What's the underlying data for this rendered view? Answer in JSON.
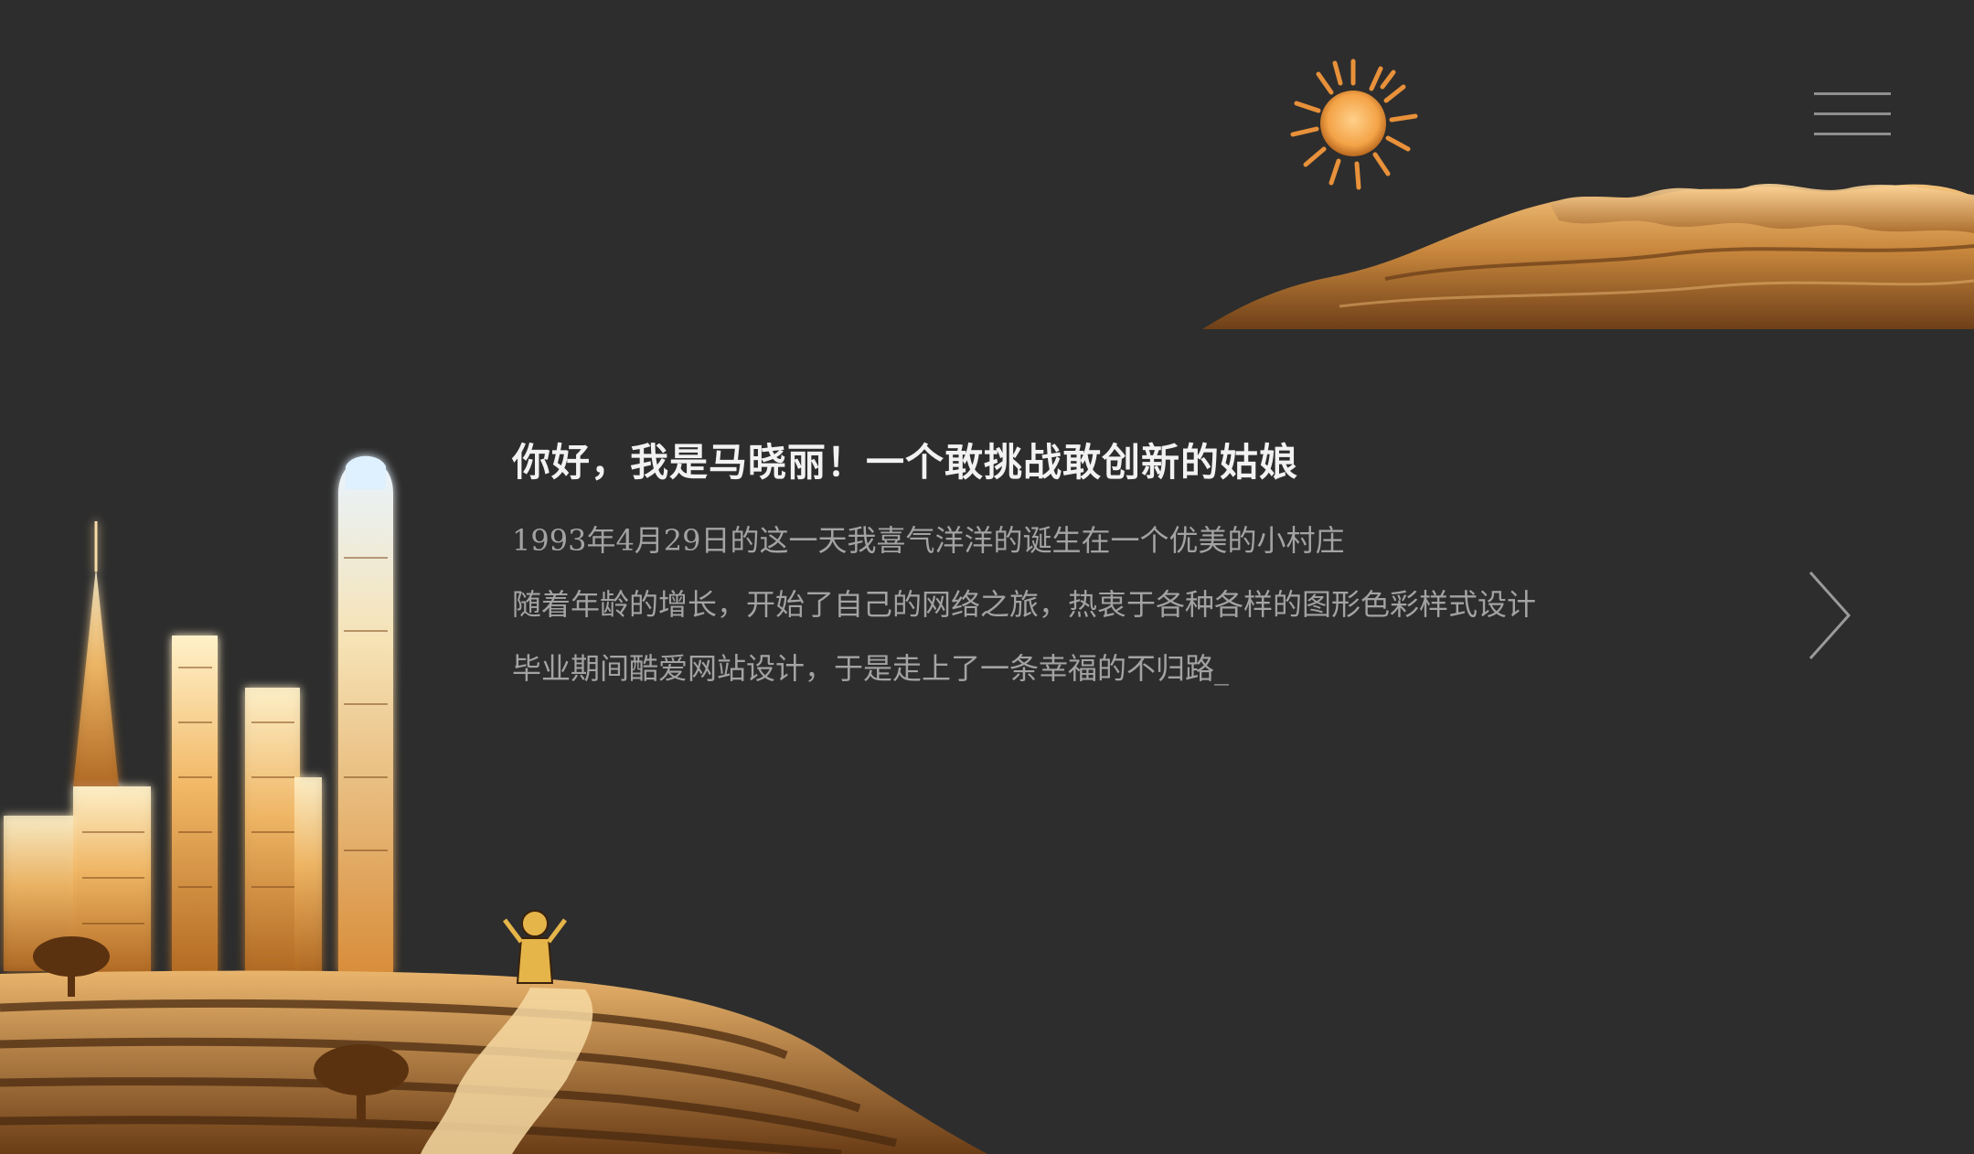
{
  "header": {
    "menu_icon": "hamburger-menu-icon",
    "sun_icon": "sun-icon"
  },
  "intro": {
    "title": "你好，我是马晓丽！一个敢挑战敢创新的姑娘",
    "lines": [
      "1993年4月29日的这一天我喜气洋洋的诞生在一个优美的小村庄",
      "随着年龄的增长，开始了自己的网络之旅，热衷于各种各样的图形色彩样式设计",
      "毕业期间酷爱网站设计，于是走上了一条幸福的不归路_"
    ]
  },
  "navigation": {
    "next_icon": "chevron-right-icon"
  },
  "colors": {
    "background": "#2d2d2d",
    "title": "#f2f2f2",
    "body_text": "#a3a3a3",
    "sand_light": "#f6c27a",
    "sand_mid": "#c8893e",
    "sand_dark": "#6b3d16",
    "sun": "#f4a347"
  }
}
